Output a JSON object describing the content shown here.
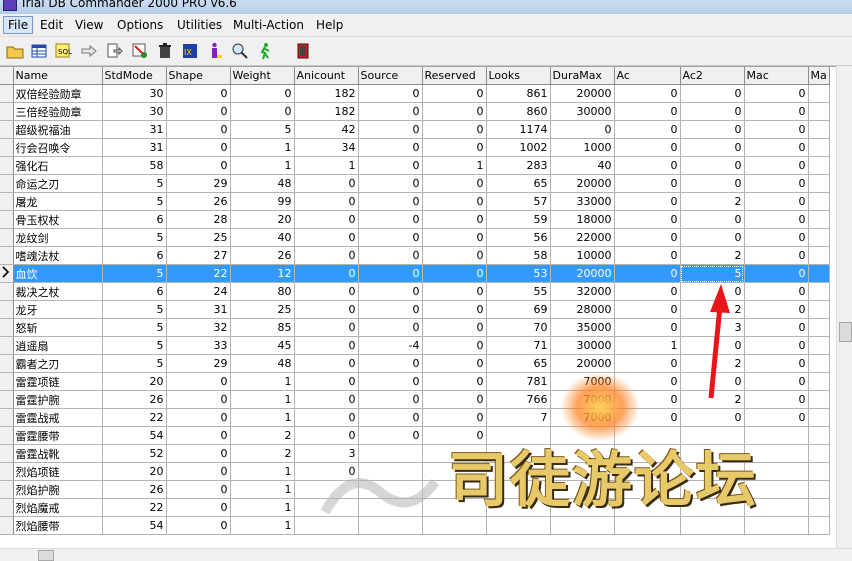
{
  "window": {
    "title": "Trial DB Commander 2000 PRO v6.6"
  },
  "menu": [
    "File",
    "Edit",
    "View",
    "Options",
    "Utilities",
    "Multi-Action",
    "Help"
  ],
  "toolbar": [
    {
      "name": "open-folder-icon",
      "icon": "folder"
    },
    {
      "name": "table-icon",
      "icon": "table"
    },
    {
      "name": "query-icon",
      "icon": "sql"
    },
    {
      "name": "arrow-right-icon",
      "icon": "arrow"
    },
    {
      "name": "export-icon",
      "icon": "export"
    },
    {
      "name": "filter-icon",
      "icon": "filter"
    },
    {
      "name": "delete-trash-icon",
      "icon": "trash"
    },
    {
      "name": "index-icon",
      "icon": "index"
    },
    {
      "name": "info-icon",
      "icon": "info"
    },
    {
      "name": "search-find-icon",
      "icon": "find"
    },
    {
      "name": "run-man-icon",
      "icon": "run"
    },
    {
      "name": "exit-door-icon",
      "icon": "exit"
    }
  ],
  "grid": {
    "columns": [
      "Name",
      "StdMode",
      "Shape",
      "Weight",
      "Anicount",
      "Source",
      "Reserved",
      "Looks",
      "DuraMax",
      "Ac",
      "Ac2",
      "Mac",
      "Ma"
    ],
    "rows": [
      [
        "双倍经验勋章",
        "30",
        "0",
        "0",
        "182",
        "0",
        "0",
        "861",
        "20000",
        "0",
        "0",
        "0"
      ],
      [
        "三倍经验勋章",
        "30",
        "0",
        "0",
        "182",
        "0",
        "0",
        "860",
        "30000",
        "0",
        "0",
        "0"
      ],
      [
        "超级祝福油",
        "31",
        "0",
        "5",
        "42",
        "0",
        "0",
        "1174",
        "0",
        "0",
        "0",
        "0"
      ],
      [
        "行会召唤令",
        "31",
        "0",
        "1",
        "34",
        "0",
        "0",
        "1002",
        "1000",
        "0",
        "0",
        "0"
      ],
      [
        "强化石",
        "58",
        "0",
        "1",
        "1",
        "0",
        "1",
        "283",
        "40",
        "0",
        "0",
        "0"
      ],
      [
        "命运之刃",
        "5",
        "29",
        "48",
        "0",
        "0",
        "0",
        "65",
        "20000",
        "0",
        "0",
        "0"
      ],
      [
        "屠龙",
        "5",
        "26",
        "99",
        "0",
        "0",
        "0",
        "57",
        "33000",
        "0",
        "2",
        "0"
      ],
      [
        "骨玉权杖",
        "6",
        "28",
        "20",
        "0",
        "0",
        "0",
        "59",
        "18000",
        "0",
        "0",
        "0"
      ],
      [
        "龙纹剑",
        "5",
        "25",
        "40",
        "0",
        "0",
        "0",
        "56",
        "22000",
        "0",
        "0",
        "0"
      ],
      [
        "嗜魂法杖",
        "6",
        "27",
        "26",
        "0",
        "0",
        "0",
        "58",
        "10000",
        "0",
        "2",
        "0"
      ],
      [
        "血饮",
        "5",
        "22",
        "12",
        "0",
        "0",
        "0",
        "53",
        "20000",
        "0",
        "5",
        "0"
      ],
      [
        "裁决之杖",
        "6",
        "24",
        "80",
        "0",
        "0",
        "0",
        "55",
        "32000",
        "0",
        "0",
        "0"
      ],
      [
        "龙牙",
        "5",
        "31",
        "25",
        "0",
        "0",
        "0",
        "69",
        "28000",
        "0",
        "2",
        "0"
      ],
      [
        "怒斩",
        "5",
        "32",
        "85",
        "0",
        "0",
        "0",
        "70",
        "35000",
        "0",
        "3",
        "0"
      ],
      [
        "逍遥扇",
        "5",
        "33",
        "45",
        "0",
        "-4",
        "0",
        "71",
        "30000",
        "1",
        "0",
        "0"
      ],
      [
        "霸者之刃",
        "5",
        "29",
        "48",
        "0",
        "0",
        "0",
        "65",
        "20000",
        "0",
        "2",
        "0"
      ],
      [
        "雷霆项链",
        "20",
        "0",
        "1",
        "0",
        "0",
        "0",
        "781",
        "7000",
        "0",
        "0",
        "0"
      ],
      [
        "雷霆护腕",
        "26",
        "0",
        "1",
        "0",
        "0",
        "0",
        "766",
        "7000",
        "0",
        "2",
        "0"
      ],
      [
        "雷霆战戒",
        "22",
        "0",
        "1",
        "0",
        "0",
        "0",
        "7",
        "7000",
        "0",
        "0",
        "0"
      ],
      [
        "雷霆腰带",
        "54",
        "0",
        "2",
        "0",
        "0",
        "0",
        "",
        "",
        "",
        "",
        ""
      ],
      [
        "雷霆战靴",
        "52",
        "0",
        "2",
        "3",
        "",
        "",
        "",
        "",
        "",
        "",
        ""
      ],
      [
        "烈焰项链",
        "20",
        "0",
        "1",
        "0",
        "",
        "",
        "",
        "",
        "",
        "",
        ""
      ],
      [
        "烈焰护腕",
        "26",
        "0",
        "1",
        "",
        "",
        "",
        "",
        "",
        "",
        "",
        ""
      ],
      [
        "烈焰魔戒",
        "22",
        "0",
        "1",
        "",
        "",
        "",
        "",
        "",
        "",
        "",
        ""
      ],
      [
        "烈焰腰带",
        "54",
        "0",
        "1",
        "",
        "",
        "",
        "",
        "",
        "",
        "",
        ""
      ]
    ],
    "selected_row": 10,
    "focused_column": "Ac2"
  },
  "watermark": {
    "text": "司徒游论坛"
  },
  "colors": {
    "selection": "#3399ff",
    "annotation_arrow": "#e8161b"
  }
}
